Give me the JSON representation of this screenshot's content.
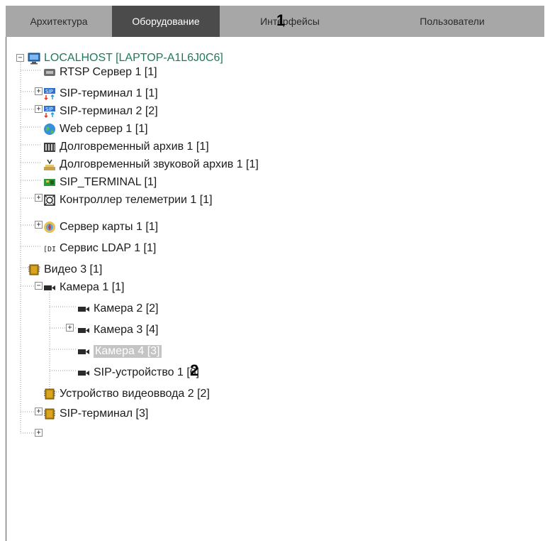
{
  "tabs": [
    "Архитектура",
    "Оборудование",
    "Интерфейсы",
    "Пользователи"
  ],
  "active_tab": "Оборудование",
  "callouts": [
    "1",
    "2"
  ],
  "tree": [
    {
      "label": "LOCALHOST [LAPTOP-A1L6J0C6]",
      "icon": "computer-icon"
    },
    {
      "label": "RTSP Сервер 1 [1]",
      "icon": "rtsp-server-icon"
    },
    {
      "label": "SIP-терминал 1 [1]",
      "icon": "sip-terminal-icon"
    },
    {
      "label": "SIP-терминал 2 [2]",
      "icon": "sip-terminal-icon"
    },
    {
      "label": "Web сервер 1 [1]",
      "icon": "globe-icon"
    },
    {
      "label": "Долговременный архив 1 [1]",
      "icon": "archive-icon"
    },
    {
      "label": "Долговременный звуковой архив 1 [1]",
      "icon": "audio-archive-icon"
    },
    {
      "label": "SIP_TERMINAL [1]",
      "icon": "board-icon"
    },
    {
      "label": "Контроллер телеметрии 1 [1]",
      "icon": "telemetry-icon"
    },
    {
      "label": "Сервер карты 1 [1]",
      "icon": "map-server-icon"
    },
    {
      "label": "Сервис LDAP 1 [1]",
      "icon": "ldap-icon"
    },
    {
      "label": "Видео 3 [1]",
      "icon": "video-chip-icon"
    },
    {
      "label": "Камера 1 [1]",
      "icon": "camera-icon"
    },
    {
      "label": "Камера 2 [2]",
      "icon": "camera-icon"
    },
    {
      "label": "Камера 3 [4]",
      "icon": "camera-icon"
    },
    {
      "label": "Камера 4 [3]",
      "icon": "camera-icon"
    },
    {
      "label": "SIP-устройство 1 [6]",
      "icon": "camera-icon"
    },
    {
      "label": "Устройство видеоввода 2 [2]",
      "icon": "video-chip-icon"
    },
    {
      "label": "SIP-терминал [3]",
      "icon": "video-chip-icon"
    }
  ],
  "selected_item": "Камера 4 [3]",
  "colors": {
    "tabbar": "#a7a7a7",
    "active_tab": "#4b4b4b",
    "root_text": "#1f7a5a",
    "selection": "#c4c4c4"
  }
}
